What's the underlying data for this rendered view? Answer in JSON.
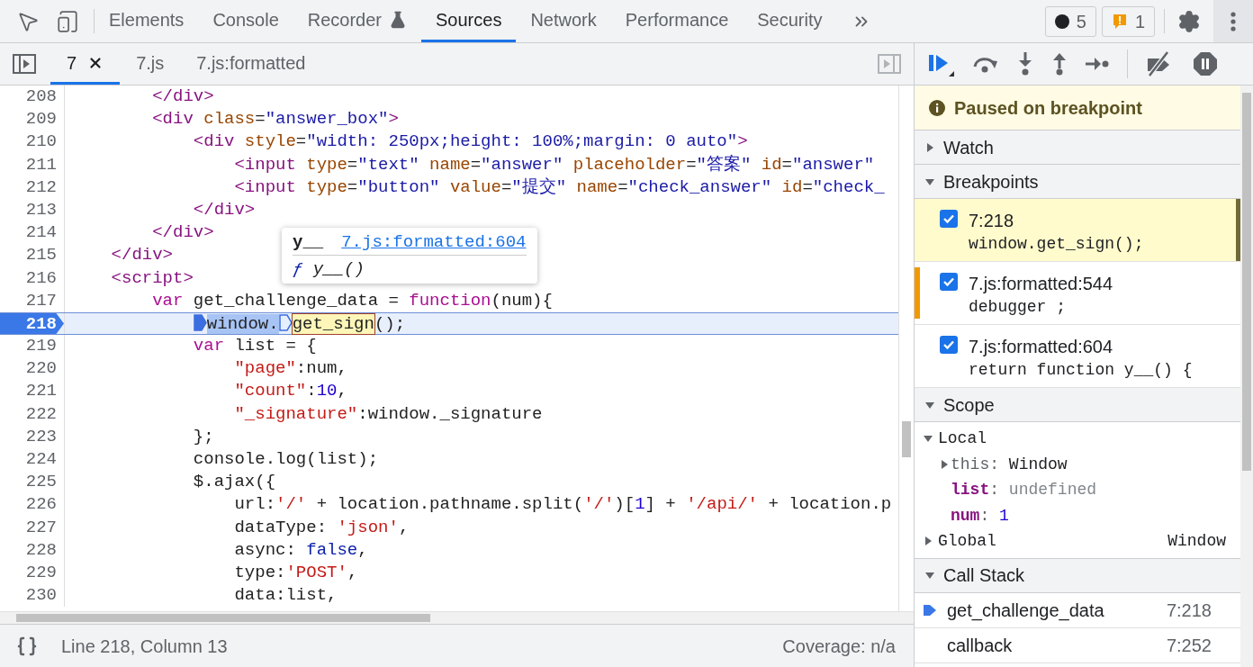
{
  "main_tabs": [
    {
      "label": "Elements",
      "selected": false,
      "experimental": false
    },
    {
      "label": "Console",
      "selected": false,
      "experimental": false
    },
    {
      "label": "Recorder",
      "selected": false,
      "experimental": true
    },
    {
      "label": "Sources",
      "selected": true,
      "experimental": false
    },
    {
      "label": "Network",
      "selected": false,
      "experimental": false
    },
    {
      "label": "Performance",
      "selected": false,
      "experimental": false
    },
    {
      "label": "Security",
      "selected": false,
      "experimental": false
    }
  ],
  "counters": [
    {
      "kind": "error",
      "count": "5"
    },
    {
      "kind": "warning",
      "count": "1"
    }
  ],
  "file_tabs": [
    {
      "label": "7",
      "selected": true,
      "closable": true
    },
    {
      "label": "7.js",
      "selected": false,
      "closable": false
    },
    {
      "label": "7.js:formatted",
      "selected": false,
      "closable": false
    }
  ],
  "code_lines": [
    {
      "number": "208",
      "current": false,
      "tokens": [
        {
          "text": "        </div>",
          "kind": "tag"
        }
      ]
    },
    {
      "number": "209",
      "current": false,
      "tokens": [
        {
          "text": "        <div ",
          "kind": "tag"
        },
        {
          "text": "class",
          "kind": "attr"
        },
        {
          "text": "=",
          "kind": "p"
        },
        {
          "text": "\"answer_box\"",
          "kind": "val"
        },
        {
          "text": ">",
          "kind": "tag"
        }
      ]
    },
    {
      "number": "210",
      "current": false,
      "tokens": [
        {
          "text": "            <div ",
          "kind": "tag"
        },
        {
          "text": "style",
          "kind": "attr"
        },
        {
          "text": "=",
          "kind": "p"
        },
        {
          "text": "\"width: 250px;height: 100%;margin: 0 auto\"",
          "kind": "val"
        },
        {
          "text": ">",
          "kind": "tag"
        }
      ]
    },
    {
      "number": "211",
      "current": false,
      "tokens": [
        {
          "text": "                <input ",
          "kind": "tag"
        },
        {
          "text": "type",
          "kind": "attr"
        },
        {
          "text": "=",
          "kind": "p"
        },
        {
          "text": "\"text\" ",
          "kind": "val"
        },
        {
          "text": "name",
          "kind": "attr"
        },
        {
          "text": "=",
          "kind": "p"
        },
        {
          "text": "\"answer\" ",
          "kind": "val"
        },
        {
          "text": "placeholder",
          "kind": "attr"
        },
        {
          "text": "=",
          "kind": "p"
        },
        {
          "text": "\"答案\" ",
          "kind": "val"
        },
        {
          "text": "id",
          "kind": "attr"
        },
        {
          "text": "=",
          "kind": "p"
        },
        {
          "text": "\"answer\"",
          "kind": "val"
        }
      ]
    },
    {
      "number": "212",
      "current": false,
      "tokens": [
        {
          "text": "                <input ",
          "kind": "tag"
        },
        {
          "text": "type",
          "kind": "attr"
        },
        {
          "text": "=",
          "kind": "p"
        },
        {
          "text": "\"button\" ",
          "kind": "val"
        },
        {
          "text": "value",
          "kind": "attr"
        },
        {
          "text": "=",
          "kind": "p"
        },
        {
          "text": "\"提交\" ",
          "kind": "val"
        },
        {
          "text": "name",
          "kind": "attr"
        },
        {
          "text": "=",
          "kind": "p"
        },
        {
          "text": "\"check_answer\" ",
          "kind": "val"
        },
        {
          "text": "id",
          "kind": "attr"
        },
        {
          "text": "=",
          "kind": "p"
        },
        {
          "text": "\"check_",
          "kind": "val"
        }
      ]
    },
    {
      "number": "213",
      "current": false,
      "tokens": [
        {
          "text": "            </div>",
          "kind": "tag"
        }
      ]
    },
    {
      "number": "214",
      "current": false,
      "tokens": [
        {
          "text": "        </div>",
          "kind": "tag"
        }
      ]
    },
    {
      "number": "215",
      "current": false,
      "tokens": [
        {
          "text": "    </div>",
          "kind": "tag"
        }
      ]
    },
    {
      "number": "216",
      "current": false,
      "tokens": [
        {
          "text": "    <script>",
          "kind": "tag"
        }
      ]
    },
    {
      "number": "217",
      "current": false,
      "tokens": [
        {
          "text": "        var ",
          "kind": "kw"
        },
        {
          "text": "get_challenge_data = ",
          "kind": "p"
        },
        {
          "text": "function",
          "kind": "kw"
        },
        {
          "text": "(num){",
          "kind": "p"
        }
      ]
    },
    {
      "number": "218",
      "current": true,
      "tokens": [
        {
          "text": "            window.",
          "kind": "sel",
          "marker": {
            "active": true
          }
        },
        {
          "text": "get_sign",
          "kind": "hover",
          "marker": {
            "active": false
          }
        },
        {
          "text": "();",
          "kind": "p"
        }
      ]
    },
    {
      "number": "219",
      "current": false,
      "tokens": [
        {
          "text": "            var ",
          "kind": "kw"
        },
        {
          "text": "list = {",
          "kind": "p"
        }
      ]
    },
    {
      "number": "220",
      "current": false,
      "tokens": [
        {
          "text": "                \"page\"",
          "kind": "str"
        },
        {
          "text": ":num,",
          "kind": "p"
        }
      ]
    },
    {
      "number": "221",
      "current": false,
      "tokens": [
        {
          "text": "                \"count\"",
          "kind": "str"
        },
        {
          "text": ":",
          "kind": "p"
        },
        {
          "text": "10",
          "kind": "num"
        },
        {
          "text": ",",
          "kind": "p"
        }
      ]
    },
    {
      "number": "222",
      "current": false,
      "tokens": [
        {
          "text": "                \"_signature\"",
          "kind": "str"
        },
        {
          "text": ":window._signature",
          "kind": "p"
        }
      ]
    },
    {
      "number": "223",
      "current": false,
      "tokens": [
        {
          "text": "            };",
          "kind": "p"
        }
      ]
    },
    {
      "number": "224",
      "current": false,
      "tokens": [
        {
          "text": "            console.log(list);",
          "kind": "p"
        }
      ]
    },
    {
      "number": "225",
      "current": false,
      "tokens": [
        {
          "text": "            $.ajax({",
          "kind": "p"
        }
      ]
    },
    {
      "number": "226",
      "current": false,
      "tokens": [
        {
          "text": "                url:",
          "kind": "p"
        },
        {
          "text": "'/'",
          "kind": "str"
        },
        {
          "text": " + location.pathname.split(",
          "kind": "p"
        },
        {
          "text": "'/'",
          "kind": "str"
        },
        {
          "text": ")[",
          "kind": "p"
        },
        {
          "text": "1",
          "kind": "num"
        },
        {
          "text": "] + ",
          "kind": "p"
        },
        {
          "text": "'/api/'",
          "kind": "str"
        },
        {
          "text": " + location.p",
          "kind": "p"
        }
      ]
    },
    {
      "number": "227",
      "current": false,
      "tokens": [
        {
          "text": "                dataType: ",
          "kind": "p"
        },
        {
          "text": "'json'",
          "kind": "str"
        },
        {
          "text": ",",
          "kind": "p"
        }
      ]
    },
    {
      "number": "228",
      "current": false,
      "tokens": [
        {
          "text": "                async: ",
          "kind": "p"
        },
        {
          "text": "false",
          "kind": "lit"
        },
        {
          "text": ",",
          "kind": "p"
        }
      ]
    },
    {
      "number": "229",
      "current": false,
      "tokens": [
        {
          "text": "                type:",
          "kind": "p"
        },
        {
          "text": "'POST'",
          "kind": "str"
        },
        {
          "text": ",",
          "kind": "p"
        }
      ]
    },
    {
      "number": "230",
      "current": false,
      "tokens": [
        {
          "text": "                data:list,",
          "kind": "p"
        }
      ]
    }
  ],
  "tooltip": {
    "name": "y__",
    "location": "7.js:formatted:604",
    "prefix": "ƒ",
    "signature": "y__()"
  },
  "status_bar": {
    "position": "Line 218, Column 13",
    "coverage": "Coverage: n/a"
  },
  "paused_message": "Paused on breakpoint",
  "sections": {
    "watch": {
      "title": "Watch",
      "expanded": false
    },
    "breakpoints": {
      "title": "Breakpoints",
      "expanded": true
    },
    "scope": {
      "title": "Scope",
      "expanded": true
    },
    "call_stack": {
      "title": "Call Stack",
      "expanded": true
    }
  },
  "breakpoints": [
    {
      "location": "7:218",
      "code": "window.get_sign();",
      "checked": true,
      "selected": true,
      "hit": false
    },
    {
      "location": "7.js:formatted:544",
      "code": "debugger ;",
      "checked": true,
      "selected": false,
      "hit": true
    },
    {
      "location": "7.js:formatted:604",
      "code": "return function y__() {",
      "checked": true,
      "selected": false,
      "hit": false
    }
  ],
  "scope": [
    {
      "name": "Local",
      "expanded": true,
      "children": [
        {
          "name": "this",
          "separator": ":",
          "value": "Window",
          "kind": "object",
          "expandable": true
        },
        {
          "name": "list",
          "separator": ":",
          "value": "undefined",
          "kind": "undefined",
          "expandable": false
        },
        {
          "name": "num",
          "separator": ":",
          "value": "1",
          "kind": "number",
          "expandable": false
        }
      ]
    },
    {
      "name": "Global",
      "expanded": false,
      "value": "Window"
    }
  ],
  "call_stack": [
    {
      "name": "get_challenge_data",
      "location": "7:218",
      "current": true
    },
    {
      "name": "callback",
      "location": "7:252",
      "current": false
    }
  ]
}
